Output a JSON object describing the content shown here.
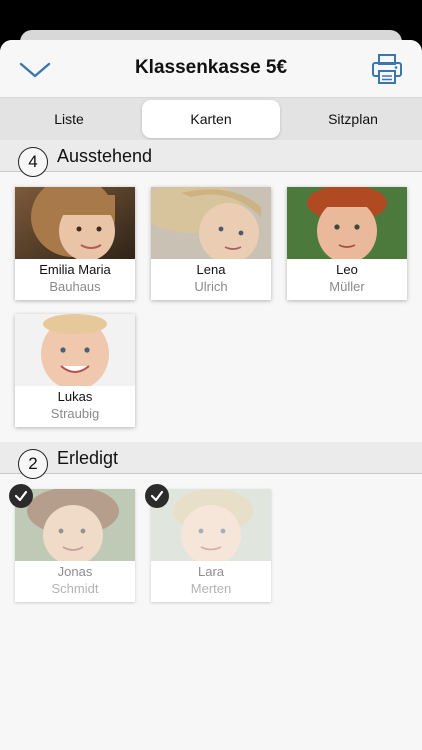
{
  "header": {
    "title": "Klassenkasse 5€",
    "back_icon": "chevron-down-icon",
    "print_icon": "printer-icon"
  },
  "tabs": [
    {
      "label": "Liste",
      "selected": false
    },
    {
      "label": "Karten",
      "selected": true
    },
    {
      "label": "Sitzplan",
      "selected": false
    }
  ],
  "sections": {
    "pending": {
      "count": "4",
      "title": "Ausstehend",
      "students": [
        {
          "first": "Emilia Maria",
          "last": "Bauhaus"
        },
        {
          "first": "Lena",
          "last": "Ulrich"
        },
        {
          "first": "Leo",
          "last": "Müller"
        },
        {
          "first": "Lukas",
          "last": "Straubig"
        }
      ]
    },
    "done": {
      "count": "2",
      "title": "Erledigt",
      "students": [
        {
          "first": "Jonas",
          "last": "Schmidt"
        },
        {
          "first": "Lara",
          "last": "Merten"
        }
      ]
    }
  },
  "colors": {
    "accent": "#2e6da4",
    "check_badge": "#2b2b2b"
  }
}
